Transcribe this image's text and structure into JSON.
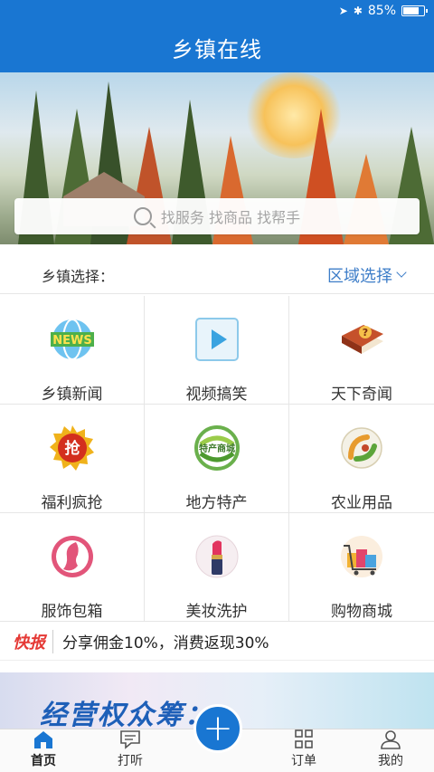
{
  "status_bar": {
    "battery_text": "85%",
    "battery_level": 0.85
  },
  "nav": {
    "title": "乡镇在线"
  },
  "search": {
    "placeholder": "找服务 找商品 找帮手"
  },
  "town_select": {
    "label": "乡镇选择：",
    "region_label": "区域选择"
  },
  "grid_items": [
    {
      "label": "乡镇新闻",
      "icon": "news-globe-icon"
    },
    {
      "label": "视频搞笑",
      "icon": "play-video-icon"
    },
    {
      "label": "天下奇闻",
      "icon": "question-book-icon"
    },
    {
      "label": "福利疯抢",
      "icon": "grab-badge-icon"
    },
    {
      "label": "地方特产",
      "icon": "specialty-mall-icon"
    },
    {
      "label": "农业用品",
      "icon": "agriculture-icon"
    },
    {
      "label": "服饰包箱",
      "icon": "fashion-face-icon"
    },
    {
      "label": "美妆洗护",
      "icon": "lipstick-icon"
    },
    {
      "label": "购物商城",
      "icon": "shopping-cart-icon"
    }
  ],
  "news_ticker": {
    "tag": "快报",
    "text": "分享佣金10%，消费返现30%"
  },
  "promo_banner": {
    "text": "经营权众筹："
  },
  "tab_bar": {
    "tabs": [
      {
        "label": "首页",
        "icon": "home-icon",
        "active": true
      },
      {
        "label": "打听",
        "icon": "message-icon",
        "active": false
      },
      {
        "label": "订单",
        "icon": "grid-icon",
        "active": false
      },
      {
        "label": "我的",
        "icon": "user-icon",
        "active": false
      }
    ],
    "center_icon": "plus-icon"
  },
  "colors": {
    "primary": "#1976d2",
    "link": "#3d7dc8",
    "news_tag": "#e53935",
    "promo_text": "#1e5fb8"
  }
}
